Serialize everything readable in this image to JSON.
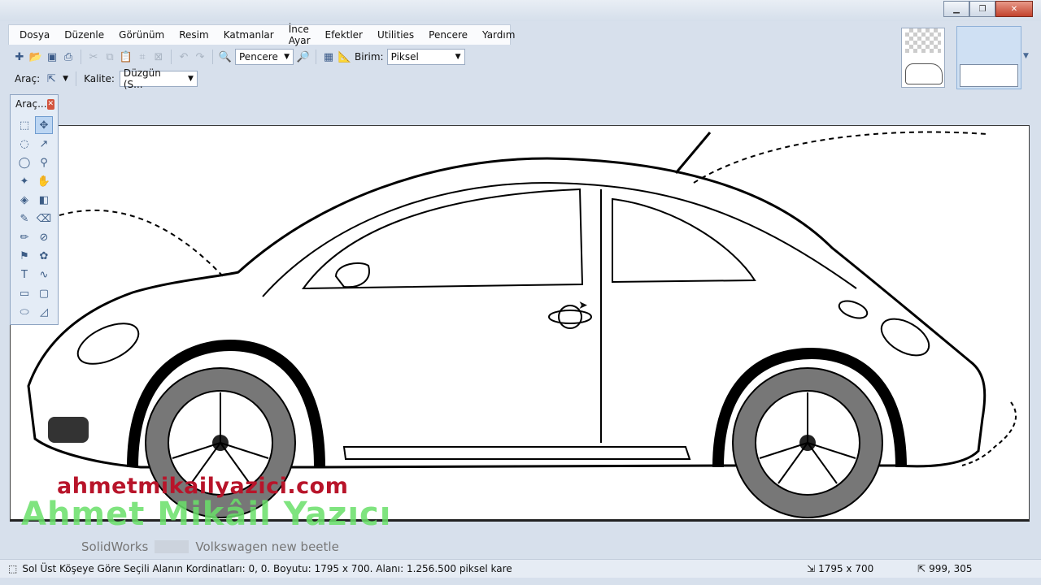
{
  "menu": {
    "items": [
      "Dosya",
      "Düzenle",
      "Görünüm",
      "Resim",
      "Katmanlar",
      "İnce Ayar",
      "Efektler",
      "Utilities",
      "Pencere",
      "Yardım"
    ]
  },
  "toolbar": {
    "zoom_value": "Pencere",
    "unit_label": "Birim:",
    "unit_value": "Piksel",
    "tool_label": "Araç:",
    "quality_label": "Kalite:",
    "quality_value": "Düzgün (S..."
  },
  "tools_window": {
    "title": "Araç...",
    "close": "✕"
  },
  "watermark": {
    "site": "ahmetmikailyazici.com",
    "name": "Ahmet Mikâil Yazıcı",
    "left_text": "SolidWorks",
    "right_text": "Volkswagen new beetle"
  },
  "status": {
    "selection_info": "Sol Üst Köşeye Göre Seçili Alanın Kordinatları: 0, 0. Boyutu: 1795 x 700. Alanı: 1.256.500 piksel kare",
    "image_size": "1795 x 700",
    "cursor_pos": "999, 305"
  },
  "icons": [
    "new-icon",
    "open-icon",
    "save-icon",
    "print-icon",
    "cut-icon",
    "copy-icon",
    "paste-icon",
    "crop-icon",
    "deselect-icon",
    "undo-icon",
    "redo-icon",
    "zoom-out-icon",
    "zoom-in-icon",
    "grid-icon",
    "ruler-icon"
  ]
}
